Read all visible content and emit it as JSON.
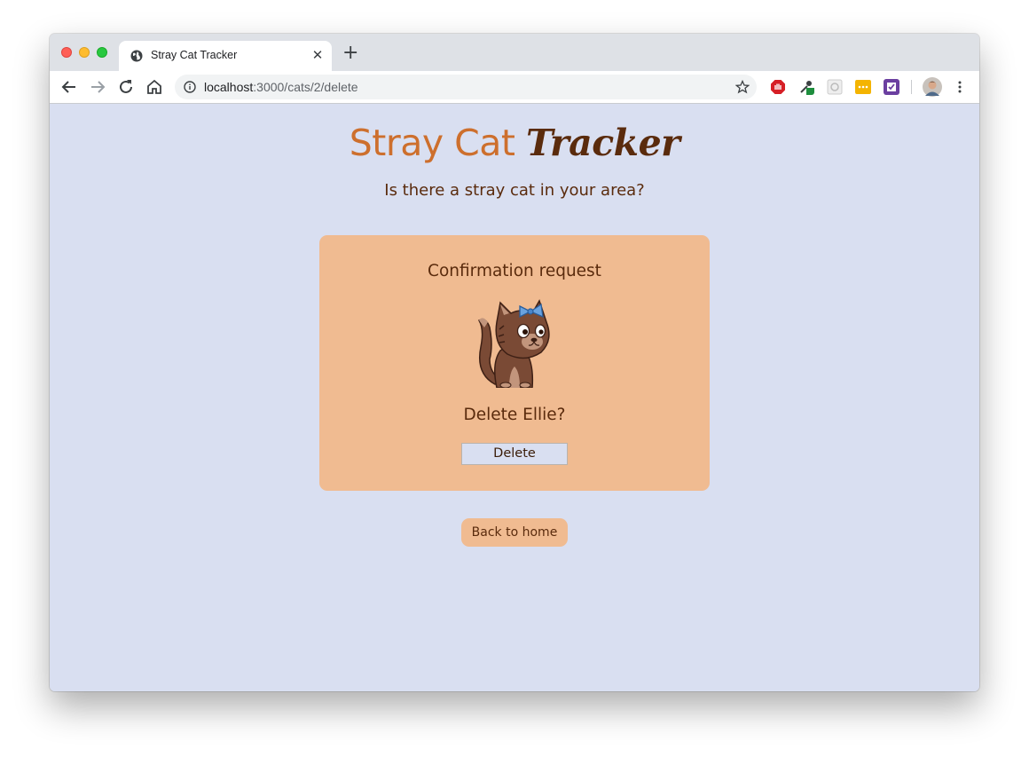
{
  "browser": {
    "tab": {
      "title": "Stray Cat Tracker"
    },
    "address": {
      "host": "localhost",
      "path": ":3000/cats/2/delete"
    }
  },
  "page": {
    "title_part1": "Stray Cat",
    "title_part2": "Tracker",
    "subtitle": "Is there a stray cat in your area?",
    "card": {
      "heading": "Confirmation request",
      "question": "Delete Ellie?",
      "delete_label": "Delete"
    },
    "back_label": "Back to home"
  },
  "colors": {
    "page_bg": "#d9dff1",
    "card_bg": "#f0bb91",
    "title_orange": "#cd6f2d",
    "text_brown": "#5a2b0d"
  },
  "icons": [
    "globe-icon",
    "close-icon",
    "plus-icon",
    "back-arrow-icon",
    "forward-arrow-icon",
    "reload-icon",
    "home-icon",
    "info-icon",
    "star-icon",
    "adblock-icon",
    "eyedropper-icon",
    "extension-icon",
    "chat-extension-icon",
    "checkbox-extension-icon",
    "avatar",
    "kebab-menu-icon"
  ]
}
